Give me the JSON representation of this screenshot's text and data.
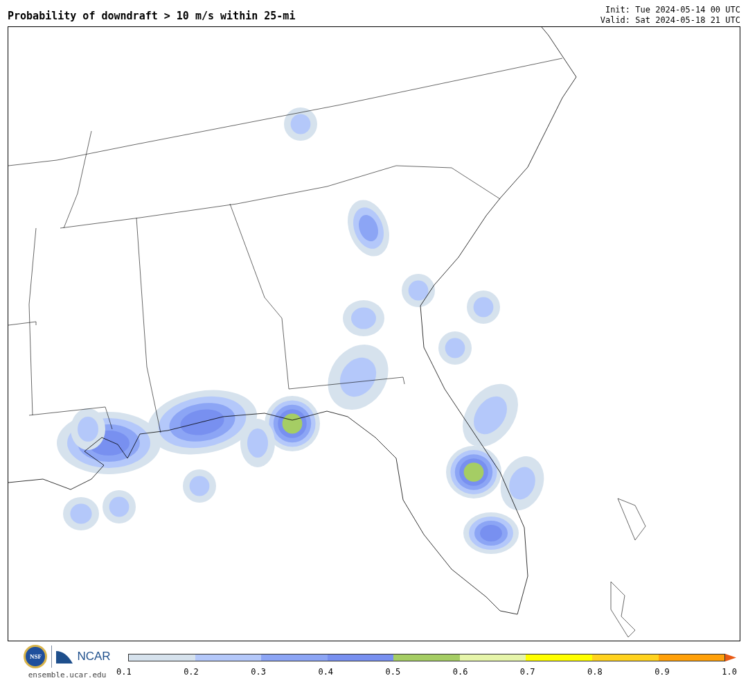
{
  "title": "Probability of downdraft > 10 m/s within 25-mi",
  "run_info": [
    "Init: Tue 2024-05-14 00 UTC",
    "Valid: Sat 2024-05-18 21 UTC"
  ],
  "logos": {
    "nsf": "NSF",
    "ncar": "NCAR",
    "url": "ensemble.ucar.edu"
  },
  "colorbar": {
    "segments": [
      {
        "color": "#d6e2ed"
      },
      {
        "color": "#b4c8fa"
      },
      {
        "color": "#8ca5f5"
      },
      {
        "color": "#7890f0"
      },
      {
        "color": "#a5cd64"
      },
      {
        "color": "#e6f5aa"
      },
      {
        "color": "#ffff00"
      },
      {
        "color": "#ffd21e"
      },
      {
        "color": "#ffa00a"
      }
    ],
    "extend": {
      "color": "#e85a14"
    },
    "ticks": [
      "0.1",
      "0.2",
      "0.3",
      "0.4",
      "0.5",
      "0.6",
      "0.7",
      "0.8",
      "0.9",
      "1.0"
    ]
  }
}
